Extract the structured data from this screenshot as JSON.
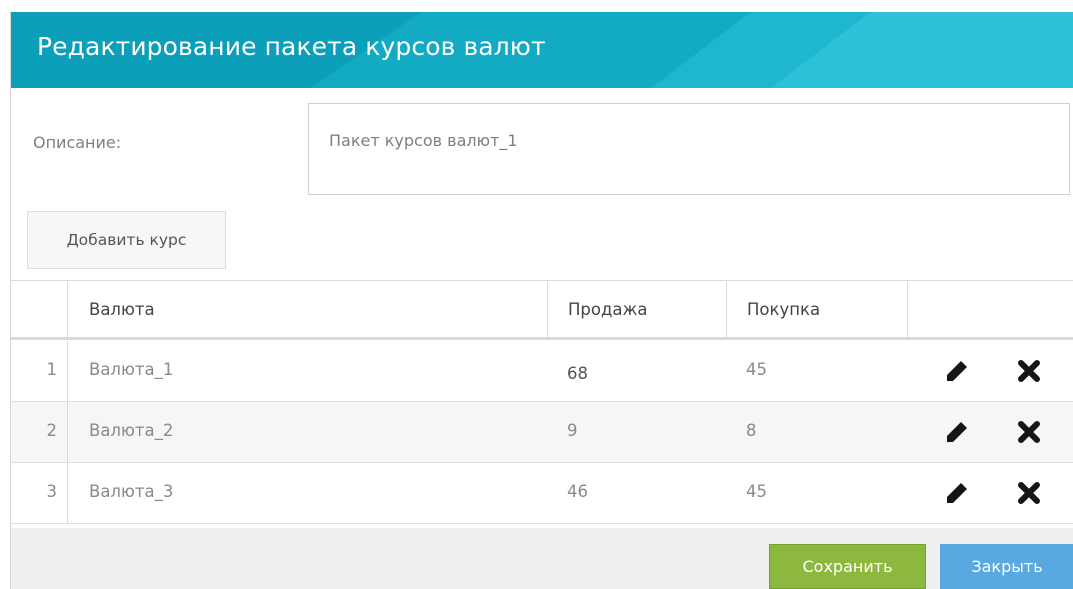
{
  "dialog": {
    "title": "Редактирование пакета курсов валют",
    "colors": {
      "header": "#0aa0bb",
      "header_light": "#2bbed7",
      "save": "#8cb83f",
      "close": "#58a9e0"
    }
  },
  "form": {
    "description_label": "Описание:",
    "description_value": "Пакет курсов валют_1",
    "add_rate_label": "Добавить курс"
  },
  "table": {
    "columns": [
      "",
      "Валюта",
      "Продажа",
      "Покупка",
      ""
    ],
    "rows": [
      {
        "index": "1",
        "currency": "Валюта_1",
        "sell": "68",
        "buy": "45"
      },
      {
        "index": "2",
        "currency": "Валюта_2",
        "sell": "9",
        "buy": "8"
      },
      {
        "index": "3",
        "currency": "Валюта_3",
        "sell": "46",
        "buy": "45"
      }
    ],
    "row_icons": [
      "pencil-icon",
      "cross-icon"
    ]
  },
  "footer": {
    "save_label": "Сохранить",
    "close_label": "Закрыть"
  }
}
